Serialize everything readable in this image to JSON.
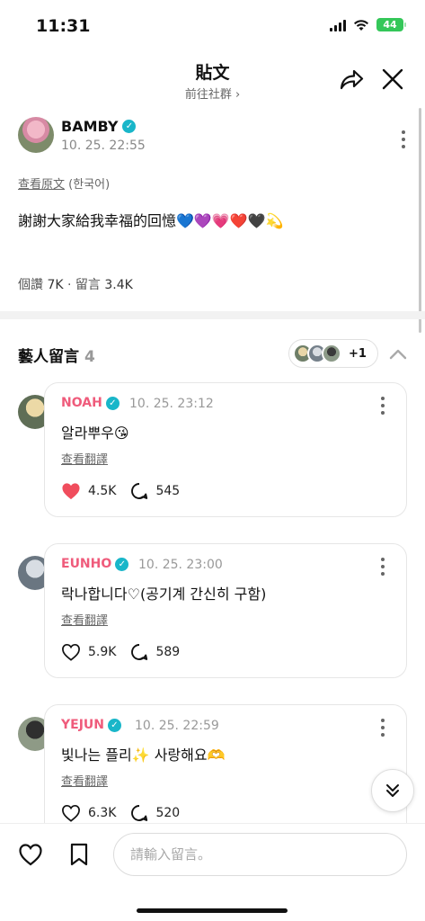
{
  "status_bar": {
    "time": "11:31",
    "battery": "44"
  },
  "header": {
    "title": "貼文",
    "subtitle": "前往社群 ›"
  },
  "post": {
    "author": "BAMBY",
    "time": "10. 25. 22:55",
    "view_original": "查看原文",
    "original_language": "(한국어)",
    "text": "謝謝大家給我幸福的回憶💙💜💗❤️🖤💫",
    "likes_label": "個讚",
    "likes": "7K",
    "separator": "·",
    "comments_label": "留言",
    "comments": "3.4K"
  },
  "artist_comments": {
    "title": "藝人留言",
    "count": "4",
    "more": "+1"
  },
  "comments": [
    {
      "name": "NOAH",
      "time": "10. 25. 23:12",
      "text": "알라뿌우😘",
      "translate": "查看翻譯",
      "likes": "4.5K",
      "replies": "545",
      "liked": true
    },
    {
      "name": "EUNHO",
      "time": "10. 25. 23:00",
      "text": "락나합니다♡(공기계 간신히 구함)",
      "translate": "查看翻譯",
      "likes": "5.9K",
      "replies": "589",
      "liked": false
    },
    {
      "name": "YEJUN",
      "time": "10. 25. 22:59",
      "text": "빛나는 플리✨ 사랑해요🫶",
      "translate": "查看翻譯",
      "likes": "6.3K",
      "replies": "520",
      "liked": false
    }
  ],
  "input": {
    "placeholder": "請輸入留言。"
  },
  "colors": {
    "accent_name": "#ef5b7b",
    "verified": "#19b6c9",
    "liked": "#f04d5d"
  }
}
